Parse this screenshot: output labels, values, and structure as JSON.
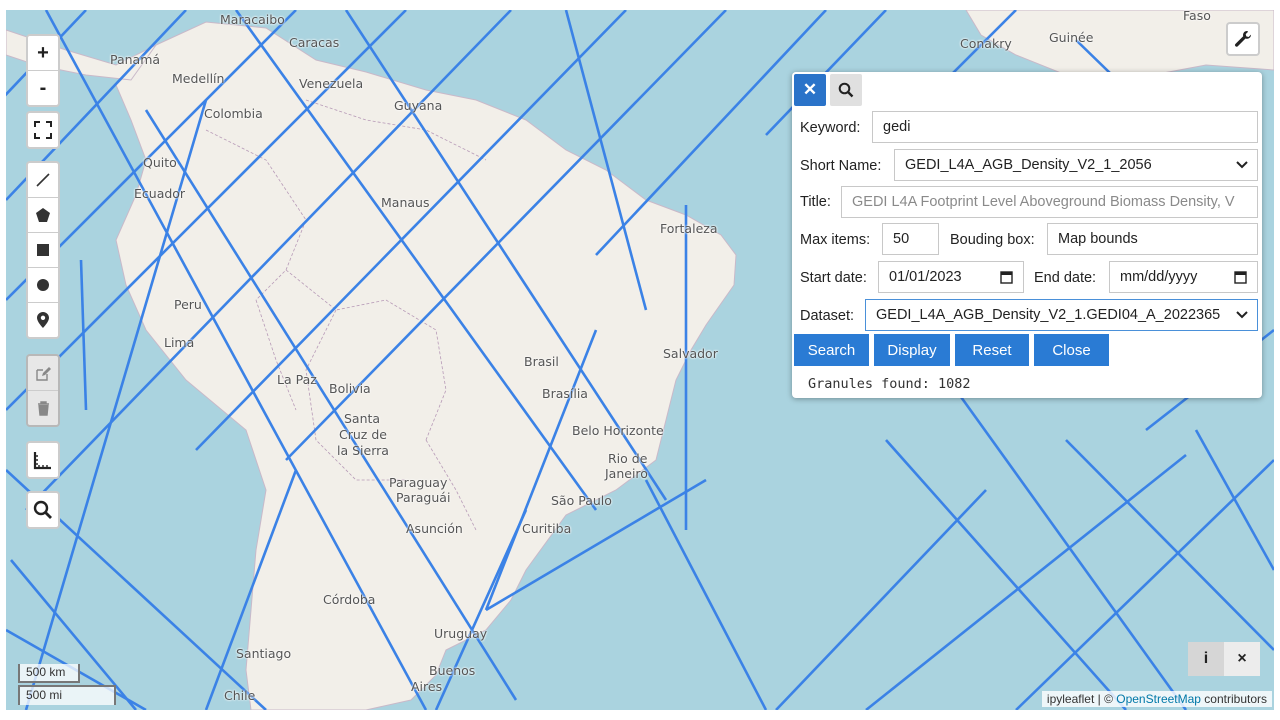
{
  "map": {
    "colors": {
      "water": "#aad3df",
      "land": "#f2efe9",
      "track": "#3b82e6"
    },
    "places": [
      {
        "label": "Maracaibo",
        "name": "place-maracaibo"
      },
      {
        "label": "Caracas",
        "name": "place-caracas"
      },
      {
        "label": "Panamá",
        "name": "place-panama"
      },
      {
        "label": "Medellín",
        "name": "place-medellin"
      },
      {
        "label": "Venezuela",
        "name": "place-venezuela"
      },
      {
        "label": "Colombia",
        "name": "place-colombia"
      },
      {
        "label": "Guyana",
        "name": "place-guyana"
      },
      {
        "label": "Quito",
        "name": "place-quito"
      },
      {
        "label": "Ecuador",
        "name": "place-ecuador"
      },
      {
        "label": "Manaus",
        "name": "place-manaus"
      },
      {
        "label": "Fortaleza",
        "name": "place-fortaleza"
      },
      {
        "label": "Peru",
        "name": "place-peru"
      },
      {
        "label": "Lima",
        "name": "place-lima"
      },
      {
        "label": "Brasil",
        "name": "place-brasil"
      },
      {
        "label": "Salvador",
        "name": "place-salvador"
      },
      {
        "label": "La Paz",
        "name": "place-lapaz"
      },
      {
        "label": "Bolivia",
        "name": "place-bolivia"
      },
      {
        "label": "Brasília",
        "name": "place-brasilia"
      },
      {
        "label": "Santa",
        "name": "place-santa"
      },
      {
        "label": "Cruz de",
        "name": "place-cruzde"
      },
      {
        "label": "la Sierra",
        "name": "place-lasierra"
      },
      {
        "label": "Belo Horizonte",
        "name": "place-belohorizonte"
      },
      {
        "label": "Rio de",
        "name": "place-riode"
      },
      {
        "label": "Janeiro",
        "name": "place-janeiro"
      },
      {
        "label": "Paraguay",
        "name": "place-paraguay"
      },
      {
        "label": "Paraguái",
        "name": "place-paraguai"
      },
      {
        "label": "São Paulo",
        "name": "place-saopaulo"
      },
      {
        "label": "Asunción",
        "name": "place-asuncion"
      },
      {
        "label": "Curitiba",
        "name": "place-curitiba"
      },
      {
        "label": "Córdoba",
        "name": "place-cordoba"
      },
      {
        "label": "Uruguay",
        "name": "place-uruguay"
      },
      {
        "label": "Santiago",
        "name": "place-santiago"
      },
      {
        "label": "Buenos",
        "name": "place-buenos"
      },
      {
        "label": "Aires",
        "name": "place-aires"
      },
      {
        "label": "Chile",
        "name": "place-chile"
      },
      {
        "label": "Conakry",
        "name": "place-conakry"
      },
      {
        "label": "Guinée",
        "name": "place-guinee"
      },
      {
        "label": "Faso",
        "name": "place-faso"
      }
    ]
  },
  "controls": {
    "zoom_in": "+",
    "zoom_out": "-"
  },
  "panel": {
    "keyword_label": "Keyword:",
    "keyword_value": "gedi",
    "short_name_label": "Short Name:",
    "short_name_value": "GEDI_L4A_AGB_Density_V2_1_2056",
    "title_label": "Title:",
    "title_value": "GEDI L4A Footprint Level Aboveground Biomass Density, V",
    "max_items_label": "Max items:",
    "max_items_value": "50",
    "bbox_label": "Bouding box:",
    "bbox_value": "Map bounds",
    "start_date_label": "Start date:",
    "start_date_value": "01/01/2023",
    "end_date_label": "End date:",
    "end_date_value": "mm/dd/yyyy",
    "dataset_label": "Dataset:",
    "dataset_value": "GEDI_L4A_AGB_Density_V2_1.GEDI04_A_2022365",
    "search_btn": "Search",
    "display_btn": "Display",
    "reset_btn": "Reset",
    "close_btn": "Close",
    "status": "Granules found: 1082"
  },
  "scale": {
    "km": "500 km",
    "mi": "500 mi"
  },
  "attribution": {
    "prefix": "ipyleaflet | © ",
    "link": "OpenStreetMap",
    "suffix": " contributors"
  },
  "bottom_controls": {
    "info": "i",
    "close": "×"
  }
}
